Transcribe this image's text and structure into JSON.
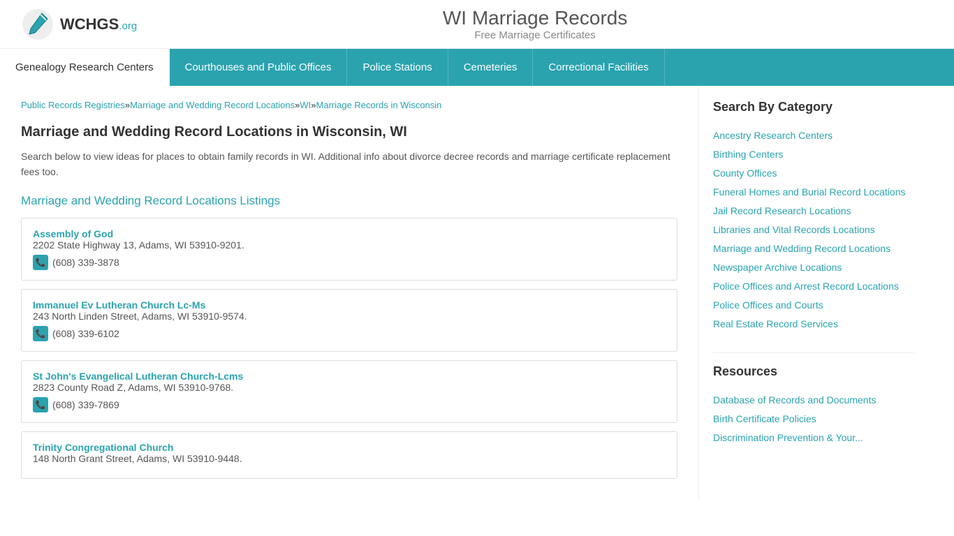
{
  "header": {
    "logo_text": "WCHGS",
    "logo_suffix": ".org",
    "site_title": "WI Marriage Records",
    "site_subtitle": "Free Marriage Certificates"
  },
  "nav": {
    "items": [
      {
        "label": "Genealogy Research Centers",
        "active": false
      },
      {
        "label": "Courthouses and Public Offices",
        "active": false
      },
      {
        "label": "Police Stations",
        "active": false
      },
      {
        "label": "Cemeteries",
        "active": false
      },
      {
        "label": "Correctional Facilities",
        "active": false
      }
    ]
  },
  "breadcrumb": {
    "items": [
      {
        "label": "Public Records Registries",
        "href": "#"
      },
      {
        "label": "Marriage and Wedding Record Locations",
        "href": "#"
      },
      {
        "label": "WI",
        "href": "#"
      },
      {
        "label": "Marriage Records in Wisconsin",
        "href": "#"
      }
    ]
  },
  "content": {
    "page_title": "Marriage and Wedding Record Locations in Wisconsin, WI",
    "description": "Search below to view ideas for places to obtain family records in WI. Additional info about divorce decree records and marriage certificate replacement fees too.",
    "listings_title": "Marriage and Wedding Record Locations Listings",
    "listings": [
      {
        "name": "Assembly of God",
        "address": "2202 State Highway 13, Adams, WI 53910-9201.",
        "phone": "(608) 339-3878"
      },
      {
        "name": "Immanuel Ev Lutheran Church Lc-Ms",
        "address": "243 North Linden Street, Adams, WI 53910-9574.",
        "phone": "(608) 339-6102"
      },
      {
        "name": "St John's Evangelical Lutheran Church-Lcms",
        "address": "2823 County Road Z, Adams, WI 53910-9768.",
        "phone": "(608) 339-7869"
      },
      {
        "name": "Trinity Congregational Church",
        "address": "148 North Grant Street, Adams, WI 53910-9448.",
        "phone": ""
      }
    ]
  },
  "sidebar": {
    "category_title": "Search By Category",
    "category_links": [
      "Ancestry Research Centers",
      "Birthing Centers",
      "County Offices",
      "Funeral Homes and Burial Record Locations",
      "Jail Record Research Locations",
      "Libraries and Vital Records Locations",
      "Marriage and Wedding Record Locations",
      "Newspaper Archive Locations",
      "Police Offices and Arrest Record Locations",
      "Police Offices and Courts",
      "Real Estate Record Services"
    ],
    "resources_title": "Resources",
    "resources_links": [
      "Database of Records and Documents",
      "Birth Certificate Policies",
      "Discrimination Prevention & Your..."
    ]
  }
}
